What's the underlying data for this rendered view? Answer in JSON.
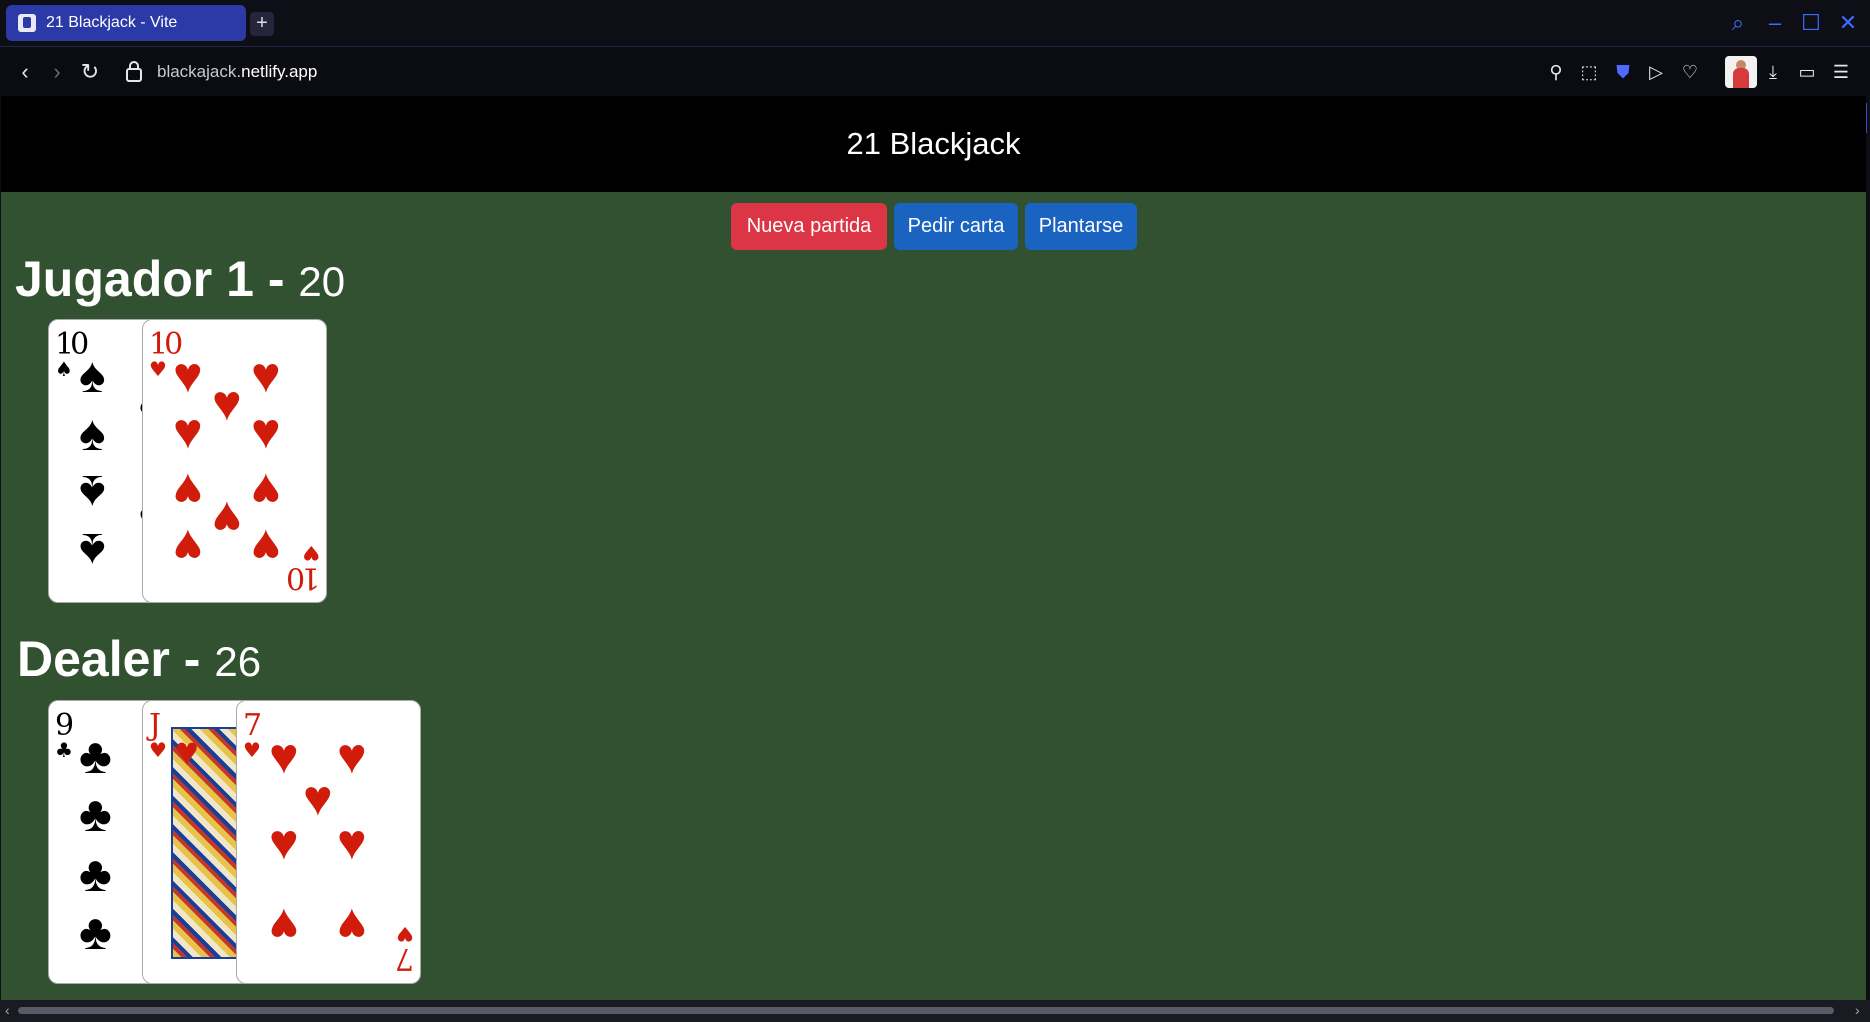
{
  "browser": {
    "tab_title": "21 Blackjack - Vite",
    "new_tab_label": "+",
    "url_host": "blackajack.",
    "url_domain": "netlify.app"
  },
  "page": {
    "header_title": "21 Blackjack",
    "buttons": {
      "new_game": "Nueva partida",
      "hit": "Pedir carta",
      "stand": "Plantarse"
    },
    "player": {
      "name": "Jugador 1",
      "separator": "-",
      "score": "20",
      "cards": [
        {
          "rank": "10",
          "suit": "♠",
          "color": "black"
        },
        {
          "rank": "10",
          "suit": "♥",
          "color": "red"
        }
      ]
    },
    "dealer": {
      "name": "Dealer",
      "separator": "-",
      "score": "26",
      "cards": [
        {
          "rank": "9",
          "suit": "♣",
          "color": "black"
        },
        {
          "rank": "J",
          "suit": "♥",
          "color": "red"
        },
        {
          "rank": "7",
          "suit": "♥",
          "color": "red"
        }
      ]
    }
  },
  "colors": {
    "felt": "#325131",
    "button_red": "#dc3545",
    "button_blue": "#1b63c1",
    "tab_accent": "#2c3aa8"
  }
}
